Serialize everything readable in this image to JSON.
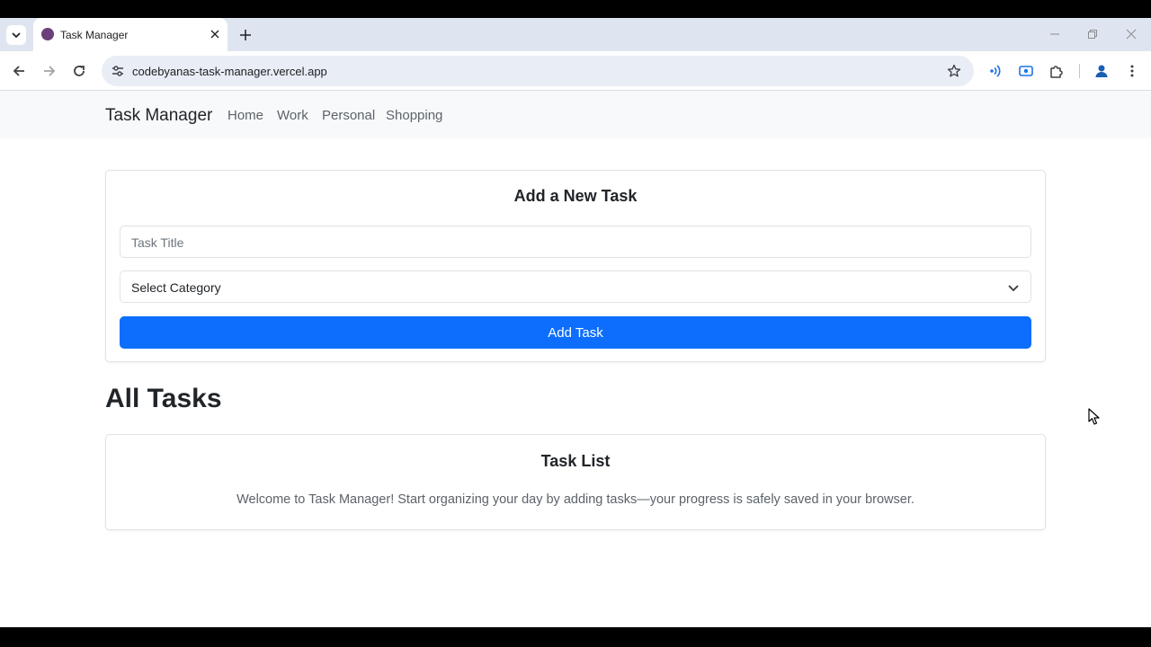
{
  "browser": {
    "tab": {
      "title": "Task Manager",
      "favicon_color": "#6b3f7a"
    },
    "url": "codebyanas-task-manager.vercel.app",
    "icons": {
      "tab_search": "chevron-down-icon",
      "tab_close": "close-icon",
      "new_tab": "plus-icon",
      "minimize": "minimize-icon",
      "restore": "restore-icon",
      "close_window": "close-icon",
      "back": "arrow-left-icon",
      "forward": "arrow-right-icon",
      "reload": "reload-icon",
      "site_info": "tune-icon",
      "bookmark": "star-icon",
      "extension_1": "broadcast-icon",
      "extension_2": "media-icon",
      "extensions": "puzzle-icon",
      "profile": "person-icon",
      "menu": "more-vertical-icon"
    }
  },
  "navbar": {
    "brand": "Task Manager",
    "links": [
      "Home",
      "Work",
      "Personal",
      "Shopping"
    ]
  },
  "add_task": {
    "title": "Add a New Task",
    "title_placeholder": "Task Title",
    "category_selected": "Select Category",
    "button_label": "Add Task"
  },
  "all_tasks": {
    "heading": "All Tasks",
    "list_title": "Task List",
    "empty_message": "Welcome to Task Manager! Start organizing your day by adding tasks—your progress is safely saved in your browser."
  },
  "colors": {
    "primary": "#0d6efd",
    "navbar_bg": "#f8f9fa",
    "text": "#212529",
    "muted": "#5c636a"
  }
}
